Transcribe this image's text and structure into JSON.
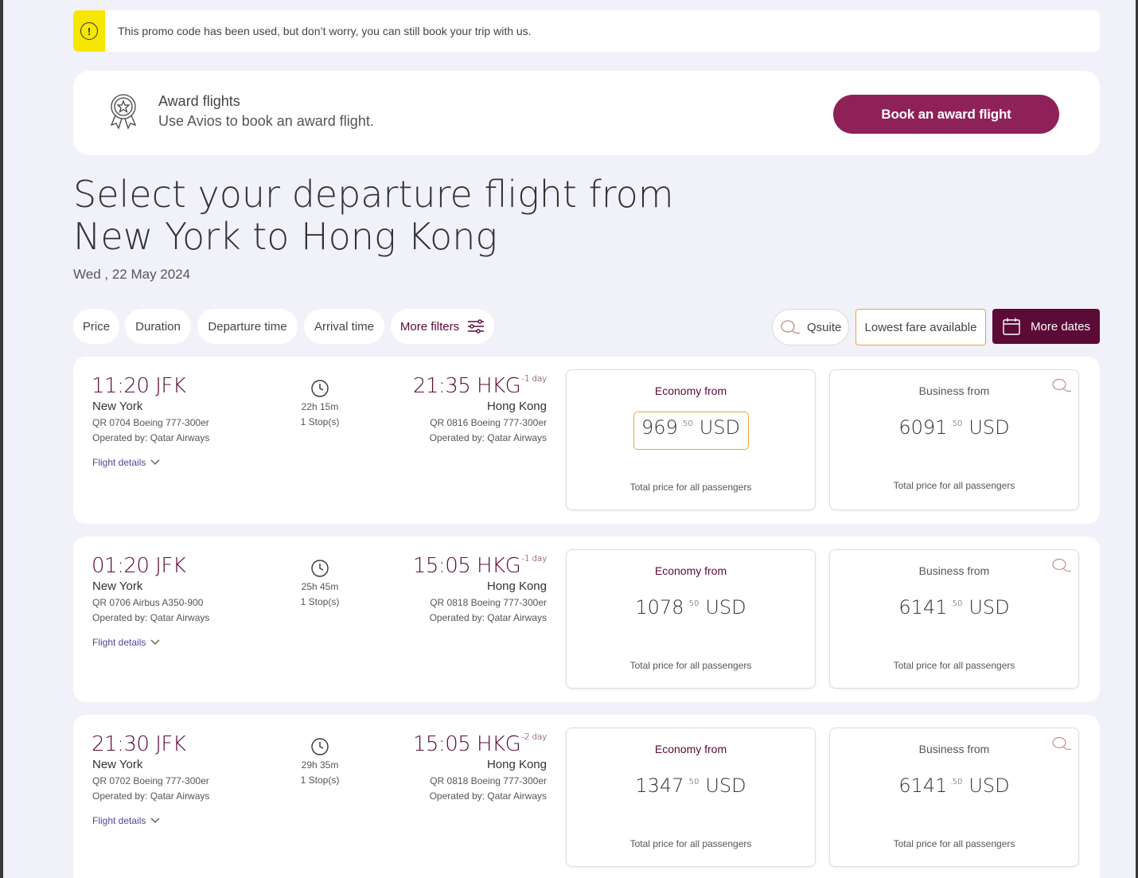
{
  "promo": {
    "icon": "exclamation-icon",
    "text": "This promo code has been used, but don’t worry, you can still book your trip with us."
  },
  "award": {
    "icon": "award-ribbon-icon",
    "title": "Award flights",
    "subtitle": "Use Avios to book an award flight.",
    "button": "Book an award flight"
  },
  "heading": {
    "line1": "Select your departure flight from",
    "line2": "New York to Hong Kong",
    "date": "Wed , 22 May 2024"
  },
  "filters": {
    "price": "Price",
    "duration": "Duration",
    "departure_time": "Departure time",
    "arrival_time": "Arrival time",
    "more_filters": "More filters",
    "qsuite": "Qsuite",
    "lowest_fare": "Lowest fare available",
    "more_dates": "More dates"
  },
  "colors": {
    "brand": "#5c0a36",
    "button": "#8e2157",
    "highlight": "#e5a642",
    "warning": "#f6e600"
  },
  "flights": [
    {
      "dep_time": "11:20 JFK",
      "dep_city": "New York",
      "dep_flight": "QR 0704 Boeing 777-300er",
      "dep_operator": "Operated by: Qatar Airways",
      "duration": "22h 15m",
      "stops": "1 Stop(s)",
      "arr_time": "21:35 HKG",
      "arr_offset": "-1 day",
      "arr_city": "Hong Kong",
      "arr_flight": "QR 0816 Boeing 777-300er",
      "arr_operator": "Operated by: Qatar Airways",
      "details": "Flight details",
      "economy_label": "Economy from",
      "economy_price": "969",
      "economy_cents": ".50",
      "economy_currency": "USD",
      "economy_note": "Total price for all passengers",
      "business_label": "Business from",
      "business_price": "6091",
      "business_cents": ".50",
      "business_currency": "USD",
      "business_note": "Total price for all passengers"
    },
    {
      "dep_time": "01:20 JFK",
      "dep_city": "New York",
      "dep_flight": "QR 0706 Airbus A350-900",
      "dep_operator": "Operated by: Qatar Airways",
      "duration": "25h 45m",
      "stops": "1 Stop(s)",
      "arr_time": "15:05 HKG",
      "arr_offset": "-1 day",
      "arr_city": "Hong Kong",
      "arr_flight": "QR 0818 Boeing 777-300er",
      "arr_operator": "Operated by: Qatar Airways",
      "details": "Flight details",
      "economy_label": "Economy from",
      "economy_price": "1078",
      "economy_cents": ".50",
      "economy_currency": "USD",
      "economy_note": "Total price for all passengers",
      "business_label": "Business from",
      "business_price": "6141",
      "business_cents": ".50",
      "business_currency": "USD",
      "business_note": "Total price for all passengers"
    },
    {
      "dep_time": "21:30 JFK",
      "dep_city": "New York",
      "dep_flight": "QR 0702 Boeing 777-300er",
      "dep_operator": "Operated by: Qatar Airways",
      "duration": "29h 35m",
      "stops": "1 Stop(s)",
      "arr_time": "15:05 HKG",
      "arr_offset": "-2 day",
      "arr_city": "Hong Kong",
      "arr_flight": "QR 0818 Boeing 777-300er",
      "arr_operator": "Operated by: Qatar Airways",
      "details": "Flight details",
      "economy_label": "Economy from",
      "economy_price": "1347",
      "economy_cents": ".50",
      "economy_currency": "USD",
      "economy_note": "Total price for all passengers",
      "business_label": "Business from",
      "business_price": "6141",
      "business_cents": ".50",
      "business_currency": "USD",
      "business_note": "Total price for all passengers"
    }
  ]
}
